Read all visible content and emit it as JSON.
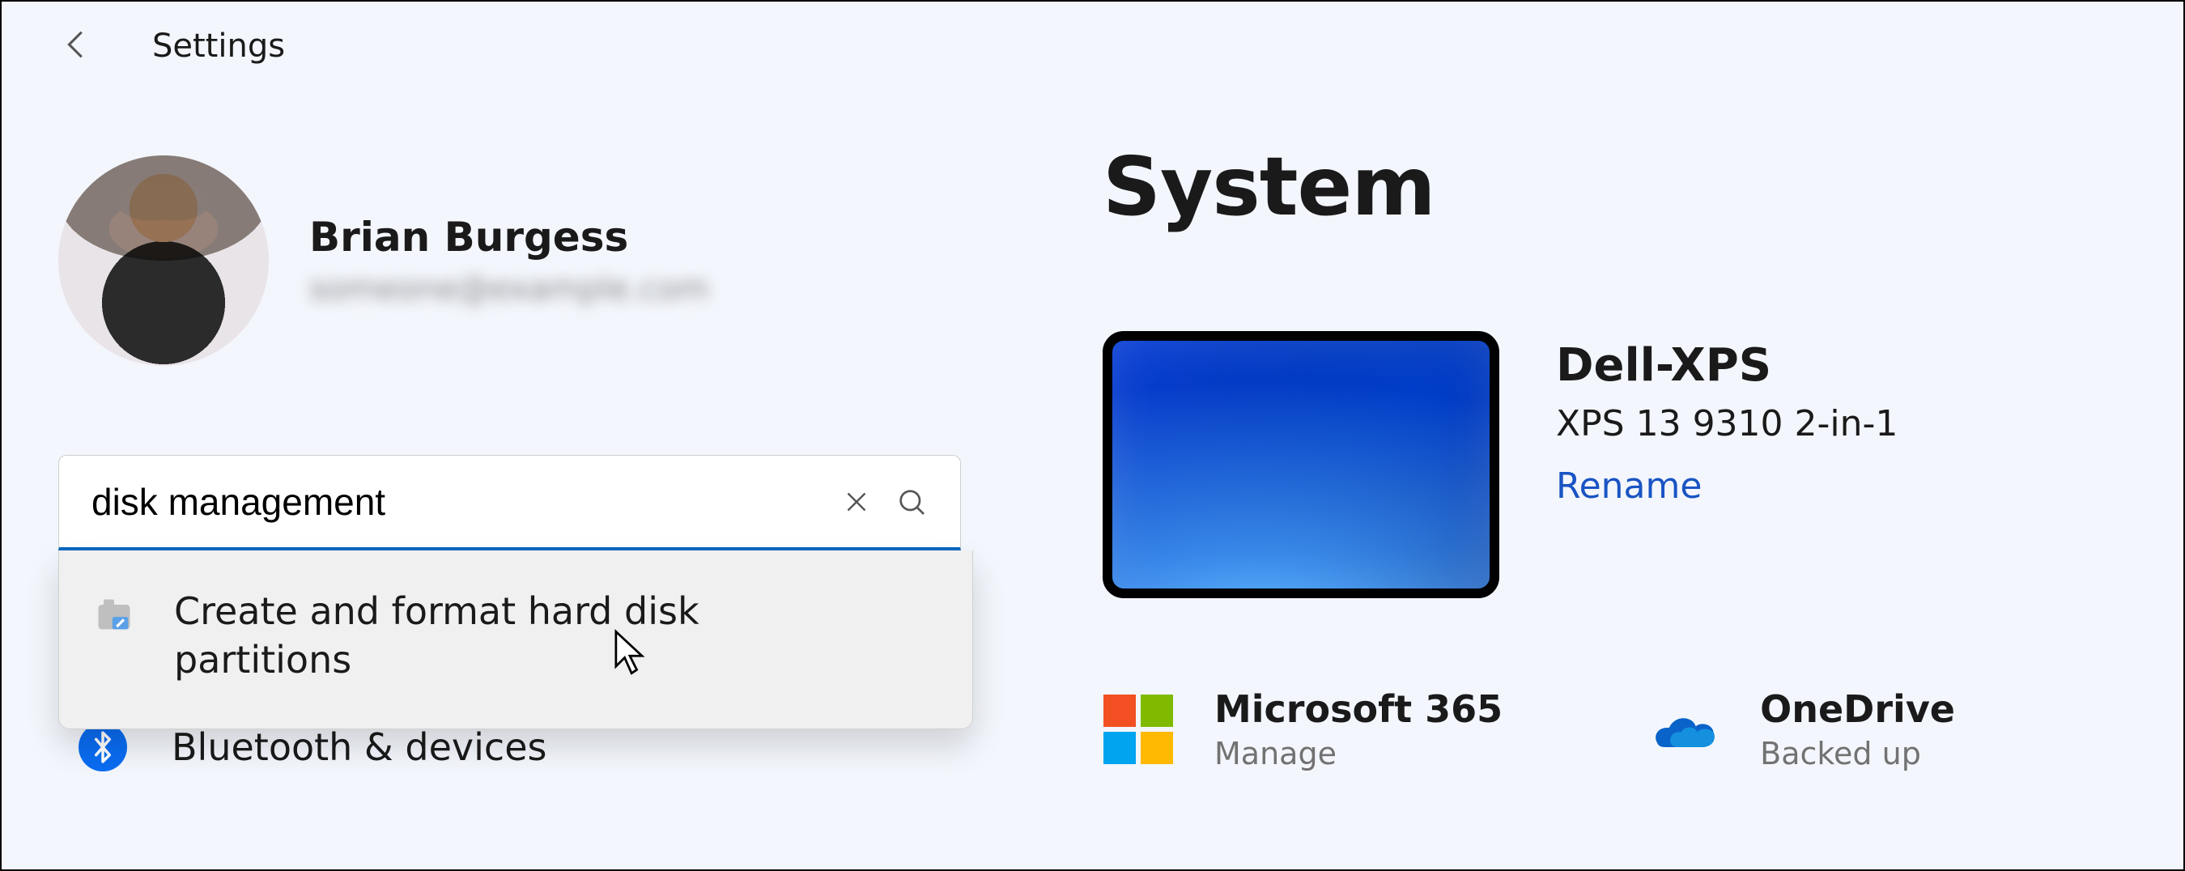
{
  "window": {
    "title": "Settings"
  },
  "user": {
    "name": "Brian Burgess",
    "email": "someone@example.com"
  },
  "search": {
    "value": "disk management",
    "clear_icon": "close-icon",
    "search_icon": "search-icon",
    "suggestions": [
      {
        "icon": "settings-gear-icon",
        "label": "Create and format hard disk partitions"
      }
    ]
  },
  "sidebar": {
    "items": [
      {
        "icon": "bluetooth-icon",
        "label": "Bluetooth & devices"
      }
    ]
  },
  "page": {
    "heading": "System",
    "device": {
      "name": "Dell-XPS",
      "model": "XPS 13 9310 2-in-1",
      "rename_label": "Rename"
    },
    "tiles": [
      {
        "icon": "microsoft-logo-icon",
        "title": "Microsoft 365",
        "subtitle": "Manage"
      },
      {
        "icon": "onedrive-icon",
        "title": "OneDrive",
        "subtitle": "Backed up"
      }
    ]
  }
}
